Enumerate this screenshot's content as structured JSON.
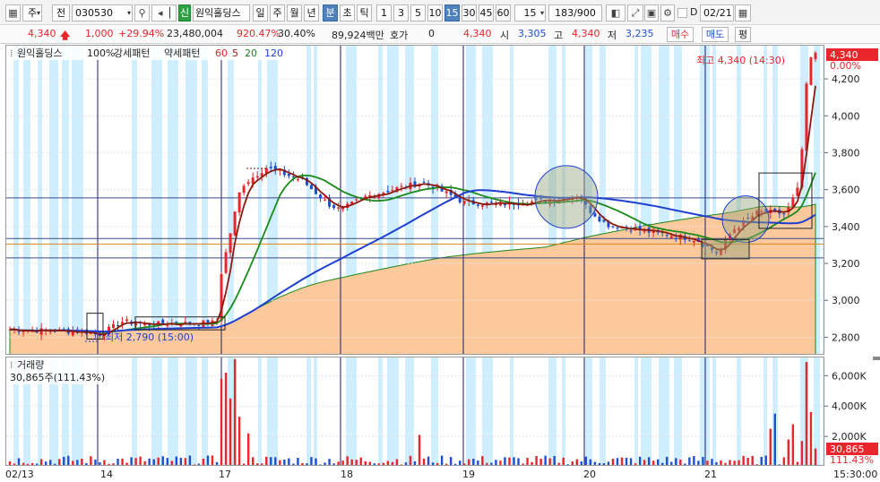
{
  "toolbar": {
    "layout_icon": "grid-icon",
    "market_select": "주",
    "scope_select": "전",
    "code": "030530",
    "badge": "신",
    "name": "원익홀딩스",
    "periods": [
      "일",
      "주",
      "월",
      "년",
      "분",
      "초",
      "틱"
    ],
    "active_period": "분",
    "minutes": [
      "1",
      "3",
      "5",
      "10",
      "15",
      "30",
      "45",
      "60"
    ],
    "active_minute": "15",
    "interval_value": "15",
    "count": "183/900",
    "checkbox_label": "D",
    "date": "02/21"
  },
  "quote": {
    "price": "4,340",
    "change": "1,000",
    "change_pct": "+29.94%",
    "volume": "23,480,004",
    "vol_ratio": "920.47%",
    "turnover_pct": "30.40%",
    "amount": "89,924백만",
    "hoga_label": "호가",
    "hoga_value": "0",
    "hoga_price": "4,340",
    "open_label": "시",
    "open": "3,305",
    "high_label": "고",
    "high": "4,340",
    "low_label": "저",
    "low": "3,235",
    "buy_button": "매수",
    "sell_button": "매도",
    "eval_button": "평"
  },
  "legend": {
    "name": "원익홀딩스",
    "scale": "100%",
    "strong": "강세패턴",
    "weak": "약세패턴",
    "ma": [
      "60",
      "5",
      "20",
      "120"
    ]
  },
  "annotations": {
    "high": "최고 4,340 (14:30)",
    "low": "최저 2,790 (15:00)"
  },
  "volume_pane": {
    "title": "거래량",
    "info": "30,865주(111.43%)"
  },
  "axis": {
    "price_ticks": [
      "4,200",
      "4,000",
      "3,800",
      "3,600",
      "3,400",
      "3,200",
      "3,000",
      "2,800"
    ],
    "price_label_current": "4,340",
    "price_label_pct": "0.00%",
    "volume_ticks": [
      "6,000K",
      "4,000K",
      "2,000K"
    ],
    "volume_label_current": "30,865",
    "volume_label_pct": "111.43%",
    "x_labels": [
      "02/13",
      "14",
      "17",
      "18",
      "19",
      "20",
      "21"
    ],
    "time_label": "15:30:00"
  },
  "colors": {
    "up": "#e8262b",
    "down": "#1f4fd1",
    "ma5": "#8b1a0e",
    "ma20": "#1a8a1a",
    "ma60": "#1f3fd1",
    "area": "#fbc99b",
    "stripe": "#cfeeff"
  },
  "chart_data": {
    "type": "candlestick",
    "title": "",
    "price_range": [
      2700,
      4380
    ],
    "ohlc_hint": {
      "open": 3305,
      "high": 4340,
      "low": 3235,
      "close": 4340
    },
    "day_labels": [
      "02/13",
      "14",
      "17",
      "18",
      "19",
      "20",
      "21"
    ],
    "volume_range_k": [
      0,
      7200
    ],
    "high_point": {
      "value": 4340,
      "time": "14:30"
    },
    "low_point": {
      "value": 2790,
      "time": "15:00"
    }
  }
}
